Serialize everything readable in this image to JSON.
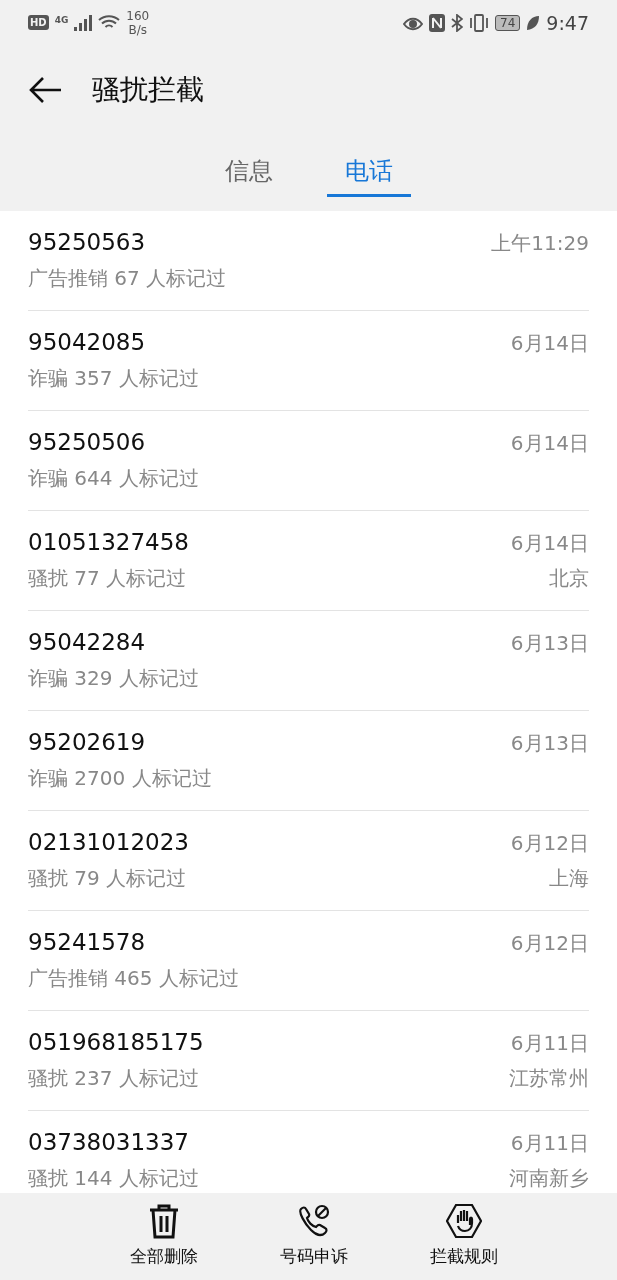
{
  "status_bar": {
    "hd_badge": "HD",
    "network": "4G",
    "speed_value": "160",
    "speed_unit": "B/s",
    "battery": "74",
    "time": "9:47"
  },
  "header": {
    "title": "骚扰拦截"
  },
  "tabs": [
    {
      "label": "信息",
      "selected": false
    },
    {
      "label": "电话",
      "selected": true
    }
  ],
  "calls": [
    {
      "number": "95250563",
      "date": "上午11:29",
      "tag": "广告推销",
      "count": "67 人标记过"
    },
    {
      "number": "95042085",
      "date": "6月14日",
      "tag": "诈骗",
      "count": "357 人标记过"
    },
    {
      "number": "95250506",
      "date": "6月14日",
      "tag": "诈骗",
      "count": "644 人标记过"
    },
    {
      "number": "01051327458",
      "date": "6月14日",
      "tag": "骚扰",
      "count": "77 人标记过",
      "location": "北京"
    },
    {
      "number": "95042284",
      "date": "6月13日",
      "tag": "诈骗",
      "count": "329 人标记过"
    },
    {
      "number": "95202619",
      "date": "6月13日",
      "tag": "诈骗",
      "count": "2700 人标记过"
    },
    {
      "number": "02131012023",
      "date": "6月12日",
      "tag": "骚扰",
      "count": "79 人标记过",
      "location": "上海"
    },
    {
      "number": "95241578",
      "date": "6月12日",
      "tag": "广告推销",
      "count": "465 人标记过"
    },
    {
      "number": "051968185175",
      "date": "6月11日",
      "tag": "骚扰",
      "count": "237 人标记过",
      "location": "江苏常州"
    },
    {
      "number": "03738031337",
      "date": "6月11日",
      "tag": "骚扰",
      "count": "144 人标记过",
      "location": "河南新乡"
    }
  ],
  "toolbar": [
    {
      "kind": "delete",
      "label": "全部删除"
    },
    {
      "kind": "appeal",
      "label": "号码申诉"
    },
    {
      "kind": "rules",
      "label": "拦截规则"
    }
  ]
}
